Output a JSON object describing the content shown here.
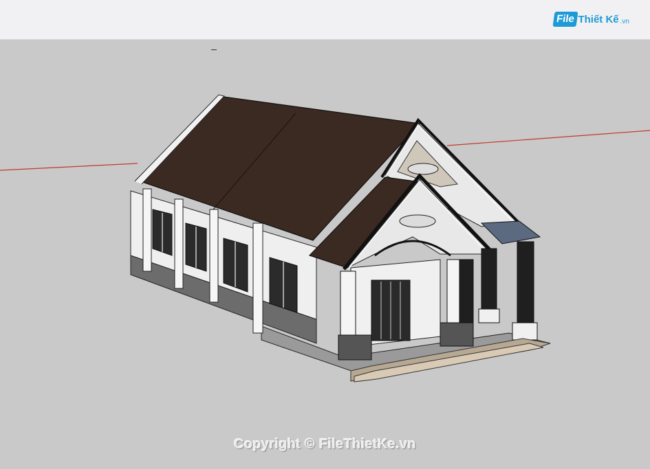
{
  "logo": {
    "badge": "File",
    "name": "Thiết Kế",
    "tld": ".vn"
  },
  "watermark": {
    "text": "Copyright © FileThietKe.vn"
  },
  "colors": {
    "background": "#c9c9c9",
    "roof": "#3a2a22",
    "wall": "#f3f3f3",
    "trim": "#1f1f1f",
    "axis_red": "#c0392b",
    "brand": "#1e9ad6"
  }
}
